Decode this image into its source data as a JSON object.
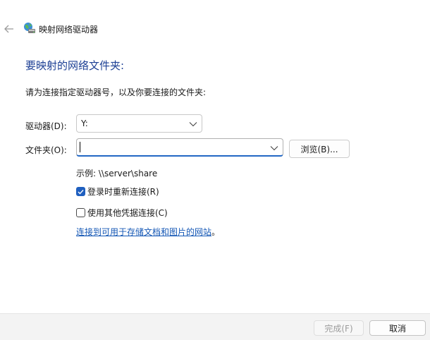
{
  "window": {
    "title": "映射网络驱动器",
    "back_icon": "arrow-left-icon",
    "app_icon": "network-drive-icon"
  },
  "main": {
    "heading": "要映射的网络文件夹:",
    "instruction": "请为连接指定驱动器号，以及你要连接的文件夹:",
    "drive": {
      "label": "驱动器(D):",
      "value": "Y:"
    },
    "folder": {
      "label": "文件夹(O):",
      "value": "",
      "placeholder": ""
    },
    "browse_label": "浏览(B)...",
    "example": "示例: \\\\server\\share",
    "reconnect": {
      "label": "登录时重新连接(R)",
      "checked": true
    },
    "credentials": {
      "label": "使用其他凭据连接(C)",
      "checked": false
    },
    "link_text": "连接到可用于存储文档和图片的网站",
    "link_suffix": "。"
  },
  "footer": {
    "finish_label": "完成(F)",
    "cancel_label": "取消"
  },
  "colors": {
    "heading": "#1c3f94",
    "accent": "#1f5fbf",
    "link": "#1457b5",
    "footer_bg": "#f3f3f3"
  }
}
